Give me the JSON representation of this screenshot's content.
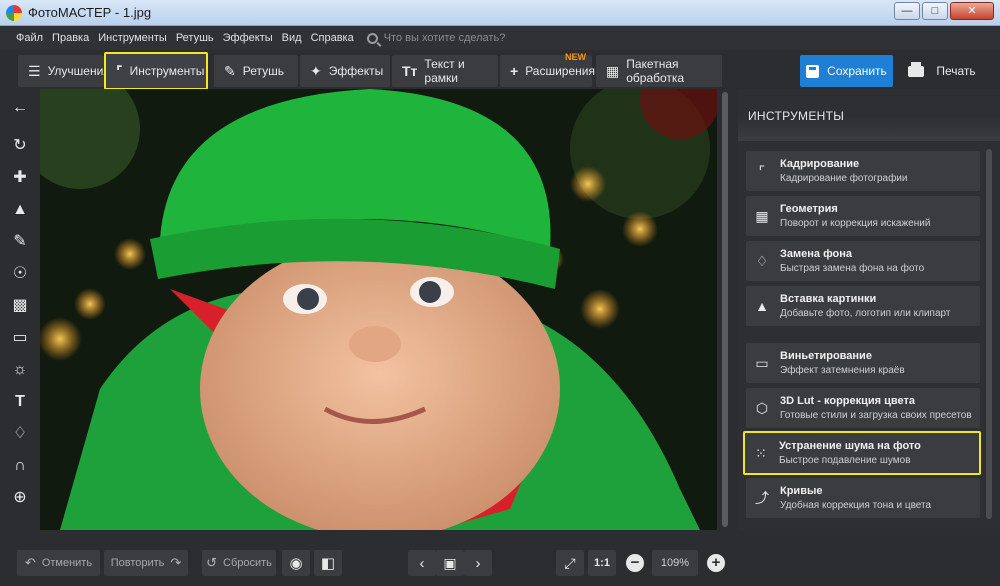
{
  "window": {
    "title": "ФотоМАСТЕР - 1.jpg"
  },
  "menu": {
    "items": [
      "Файл",
      "Правка",
      "Инструменты",
      "Ретушь",
      "Эффекты",
      "Вид",
      "Справка"
    ],
    "search_placeholder": "Что вы хотите сделать?"
  },
  "toolbar": {
    "tabs": [
      {
        "label": "Улучшения",
        "icon": "sliders-icon"
      },
      {
        "label": "Инструменты",
        "icon": "crop-icon",
        "active": true
      },
      {
        "label": "Ретушь",
        "icon": "brush-icon"
      },
      {
        "label": "Эффекты",
        "icon": "magic-wand-icon"
      },
      {
        "label": "Текст и рамки",
        "icon": "text-icon"
      },
      {
        "label": "Расширения",
        "icon": "plus-icon",
        "badge": "NEW"
      },
      {
        "label": "Пакетная обработка",
        "icon": "batch-icon"
      }
    ],
    "save_label": "Сохранить",
    "print_label": "Печать"
  },
  "left_tools": [
    "back-arrow-icon",
    "rotate-icon",
    "healing-icon",
    "stamp-icon",
    "brush-icon",
    "radial-filter-icon",
    "gradient-filter-icon",
    "vignette-icon",
    "light-icon",
    "text-icon",
    "fill-icon",
    "horseshoe-icon",
    "crosshair-icon"
  ],
  "panel": {
    "title": "ИНСТРУМЕНТЫ",
    "items": [
      {
        "title": "Кадрирование",
        "subtitle": "Кадрирование фотографии",
        "icon": "crop-icon"
      },
      {
        "title": "Геометрия",
        "subtitle": "Поворот и коррекция искажений",
        "icon": "image-icon"
      },
      {
        "title": "Замена фона",
        "subtitle": "Быстрая замена фона на фото",
        "icon": "paint-bucket-icon"
      },
      {
        "title": "Вставка картинки",
        "subtitle": "Добавьте фото, логотип или клипарт",
        "icon": "insert-image-icon"
      },
      {
        "title": "Виньетирование",
        "subtitle": "Эффект затемнения краёв",
        "icon": "vignette-icon"
      },
      {
        "title": "3D Lut - коррекция цвета",
        "subtitle": "Готовые стили и загрузка своих пресетов",
        "icon": "cube-icon"
      },
      {
        "title": "Устранение шума на фото",
        "subtitle": "Быстрое подавление шумов",
        "icon": "noise-icon",
        "highlighted": true
      },
      {
        "title": "Кривые",
        "subtitle": "Удобная коррекция тона и цвета",
        "icon": "curves-icon"
      }
    ]
  },
  "bottom": {
    "undo_label": "Отменить",
    "redo_label": "Повторить",
    "reset_label": "Сбросить",
    "zoom_one_to_one": "1:1",
    "zoom_value": "109%"
  },
  "colors": {
    "accent_blue": "#1e7fd4",
    "highlight_yellow": "#f5e71d",
    "background": "#2b2d30",
    "new_badge": "#f39c12"
  }
}
